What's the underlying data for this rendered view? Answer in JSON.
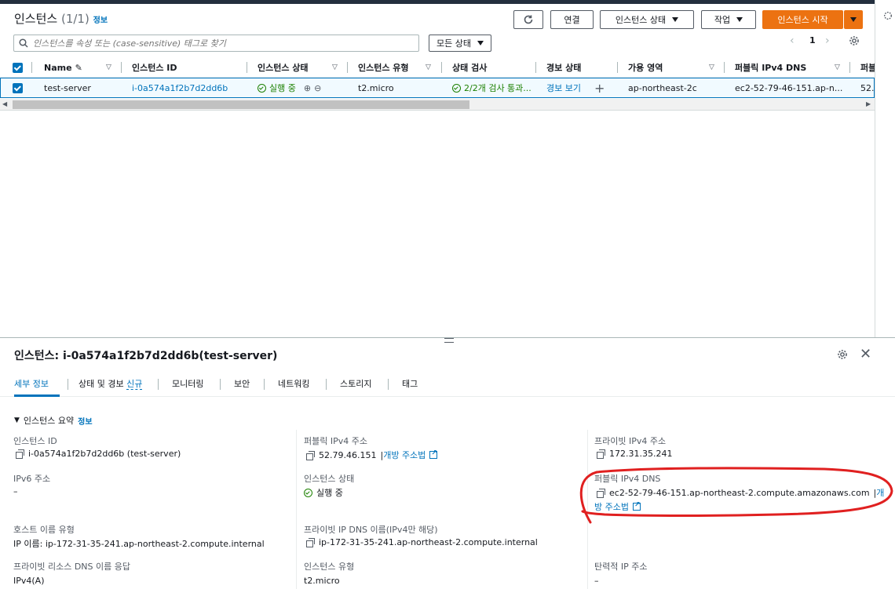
{
  "header": {
    "title": "인스턴스",
    "count": "(1/1)",
    "info_label": "정보",
    "refresh_icon": "refresh-icon",
    "connect_label": "연결",
    "instance_state_label": "인스턴스 상태",
    "actions_label": "작업",
    "launch_label": "인스턴스 시작"
  },
  "search": {
    "placeholder": "인스턴스를 속성 또는 (case-sensitive) 태그로 찾기"
  },
  "filter": {
    "state_label": "모든 상태"
  },
  "pagination": {
    "page": "1"
  },
  "table": {
    "columns": [
      "Name",
      "인스턴스 ID",
      "인스턴스 상태",
      "인스턴스 유형",
      "상태 검사",
      "경보 상태",
      "가용 영역",
      "퍼블릭 IPv4 DNS",
      "퍼블"
    ],
    "row": {
      "name": "test-server",
      "instance_id": "i-0a574a1f2b7d2dd6b",
      "state": "실행 중",
      "type": "t2.micro",
      "status_check": "2/2개 검사 통과...",
      "alarm": "경보 보기",
      "zone": "ap-northeast-2c",
      "dns": "ec2-52-79-46-151.ap-n...",
      "public_ip_partial": "52.7"
    }
  },
  "detail": {
    "title": "인스턴스: i-0a574a1f2b7d2dd6b(test-server)",
    "tabs": [
      "세부 정보",
      "상태 및 경보",
      "신규",
      "모니터링",
      "보안",
      "네트워킹",
      "스토리지",
      "태그"
    ],
    "section_title": "인스턴스 요약",
    "section_info": "정보",
    "fields": {
      "instance_id_label": "인스턴스 ID",
      "instance_id_value": "i-0a574a1f2b7d2dd6b (test-server)",
      "public_ipv4_label": "퍼블릭 IPv4 주소",
      "public_ipv4_value": "52.79.46.151",
      "open_address_label": "개방 주소법",
      "private_ipv4_label": "프라이빗 IPv4 주소",
      "private_ipv4_value": "172.31.35.241",
      "ipv6_label": "IPv6 주소",
      "ipv6_value": "–",
      "instance_state_label": "인스턴스 상태",
      "instance_state_value": "실행 중",
      "public_dns_label": "퍼블릭 IPv4 DNS",
      "public_dns_value": "ec2-52-79-46-151.ap-northeast-2.compute.amazonaws.com",
      "public_dns_link_part1": "개",
      "public_dns_link_part2": "방 주소법",
      "hostname_type_label": "호스트 이름 유형",
      "hostname_type_value": "IP 이름: ip-172-31-35-241.ap-northeast-2.compute.internal",
      "private_dns_label": "프라이빗 IP DNS 이름(IPv4만 해당)",
      "private_dns_value": "ip-172-31-35-241.ap-northeast-2.compute.internal",
      "private_resource_dns_label": "프라이빗 리소스 DNS 이름 응답",
      "private_resource_dns_value": "IPv4(A)",
      "instance_type_label": "인스턴스 유형",
      "instance_type_value": "t2.micro",
      "elastic_ip_label": "탄력적 IP 주소",
      "elastic_ip_value": "–"
    }
  },
  "colors": {
    "accent": "#0073bb",
    "primary_button": "#ec7211",
    "success": "#1d8102",
    "annotation": "#e02020"
  }
}
